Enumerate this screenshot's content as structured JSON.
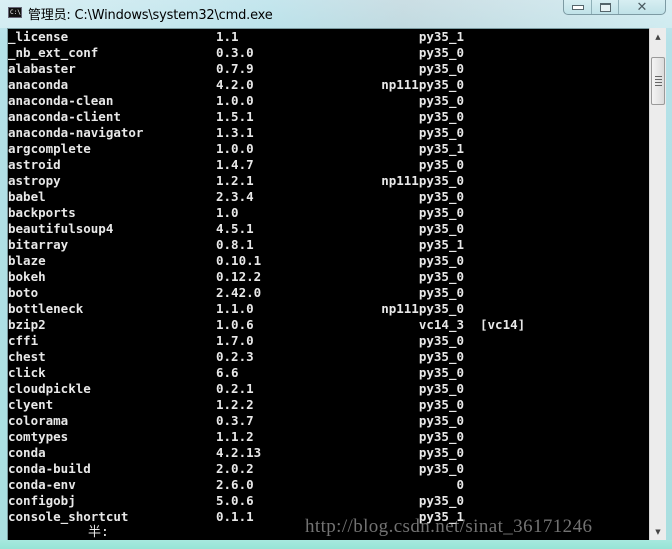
{
  "window": {
    "title": "管理员: C:\\Windows\\system32\\cmd.exe",
    "app_icon_text": "C:\\",
    "buttons": {
      "minimize": "minimize",
      "maximize": "maximize",
      "close": "✕"
    }
  },
  "console": {
    "rows": [
      {
        "name": "_license",
        "version": "1.1",
        "build": "py35_1",
        "channel": ""
      },
      {
        "name": "_nb_ext_conf",
        "version": "0.3.0",
        "build": "py35_0",
        "channel": ""
      },
      {
        "name": "alabaster",
        "version": "0.7.9",
        "build": "py35_0",
        "channel": ""
      },
      {
        "name": "anaconda",
        "version": "4.2.0",
        "build": "np111py35_0",
        "channel": ""
      },
      {
        "name": "anaconda-clean",
        "version": "1.0.0",
        "build": "py35_0",
        "channel": ""
      },
      {
        "name": "anaconda-client",
        "version": "1.5.1",
        "build": "py35_0",
        "channel": ""
      },
      {
        "name": "anaconda-navigator",
        "version": "1.3.1",
        "build": "py35_0",
        "channel": ""
      },
      {
        "name": "argcomplete",
        "version": "1.0.0",
        "build": "py35_1",
        "channel": ""
      },
      {
        "name": "astroid",
        "version": "1.4.7",
        "build": "py35_0",
        "channel": ""
      },
      {
        "name": "astropy",
        "version": "1.2.1",
        "build": "np111py35_0",
        "channel": ""
      },
      {
        "name": "babel",
        "version": "2.3.4",
        "build": "py35_0",
        "channel": ""
      },
      {
        "name": "backports",
        "version": "1.0",
        "build": "py35_0",
        "channel": ""
      },
      {
        "name": "beautifulsoup4",
        "version": "4.5.1",
        "build": "py35_0",
        "channel": ""
      },
      {
        "name": "bitarray",
        "version": "0.8.1",
        "build": "py35_1",
        "channel": ""
      },
      {
        "name": "blaze",
        "version": "0.10.1",
        "build": "py35_0",
        "channel": ""
      },
      {
        "name": "bokeh",
        "version": "0.12.2",
        "build": "py35_0",
        "channel": ""
      },
      {
        "name": "boto",
        "version": "2.42.0",
        "build": "py35_0",
        "channel": ""
      },
      {
        "name": "bottleneck",
        "version": "1.1.0",
        "build": "np111py35_0",
        "channel": ""
      },
      {
        "name": "bzip2",
        "version": "1.0.6",
        "build": "vc14_3",
        "channel": "[vc14]"
      },
      {
        "name": "cffi",
        "version": "1.7.0",
        "build": "py35_0",
        "channel": ""
      },
      {
        "name": "chest",
        "version": "0.2.3",
        "build": "py35_0",
        "channel": ""
      },
      {
        "name": "click",
        "version": "6.6",
        "build": "py35_0",
        "channel": ""
      },
      {
        "name": "cloudpickle",
        "version": "0.2.1",
        "build": "py35_0",
        "channel": ""
      },
      {
        "name": "clyent",
        "version": "1.2.2",
        "build": "py35_0",
        "channel": ""
      },
      {
        "name": "colorama",
        "version": "0.3.7",
        "build": "py35_0",
        "channel": ""
      },
      {
        "name": "comtypes",
        "version": "1.1.2",
        "build": "py35_0",
        "channel": ""
      },
      {
        "name": "conda",
        "version": "4.2.13",
        "build": "py35_0",
        "channel": ""
      },
      {
        "name": "conda-build",
        "version": "2.0.2",
        "build": "py35_0",
        "channel": ""
      },
      {
        "name": "conda-env",
        "version": "2.6.0",
        "build": "0",
        "channel": ""
      },
      {
        "name": "configobj",
        "version": "5.0.6",
        "build": "py35_0",
        "channel": ""
      },
      {
        "name": "console_shortcut",
        "version": "0.1.1",
        "build": "py35_1",
        "channel": ""
      }
    ],
    "ime_status": "半:"
  },
  "watermark": "http://blog.csdn.net/sinat_36171246",
  "scrollbar": {
    "up_arrow": "▲",
    "down_arrow": "▼"
  }
}
